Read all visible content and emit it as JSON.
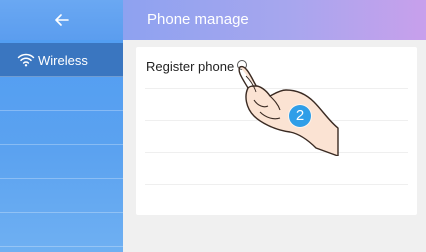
{
  "header": {
    "title": "Phone manage"
  },
  "sidebar": {
    "back_icon": "back-arrow-icon",
    "items": [
      {
        "label": "Wireless",
        "icon": "wifi-icon",
        "active": true
      }
    ]
  },
  "main": {
    "register_label": "Register phone"
  },
  "overlay": {
    "step_number": "2",
    "hand_icon": "pointing-hand-icon"
  },
  "colors": {
    "sidebar": "#5ba2f0",
    "sidebar_active": "#3a76c0",
    "header_start": "#8ea2f0",
    "header_end": "#c8a0ec",
    "background": "#f0f0f0",
    "badge": "#2f9ee8"
  }
}
